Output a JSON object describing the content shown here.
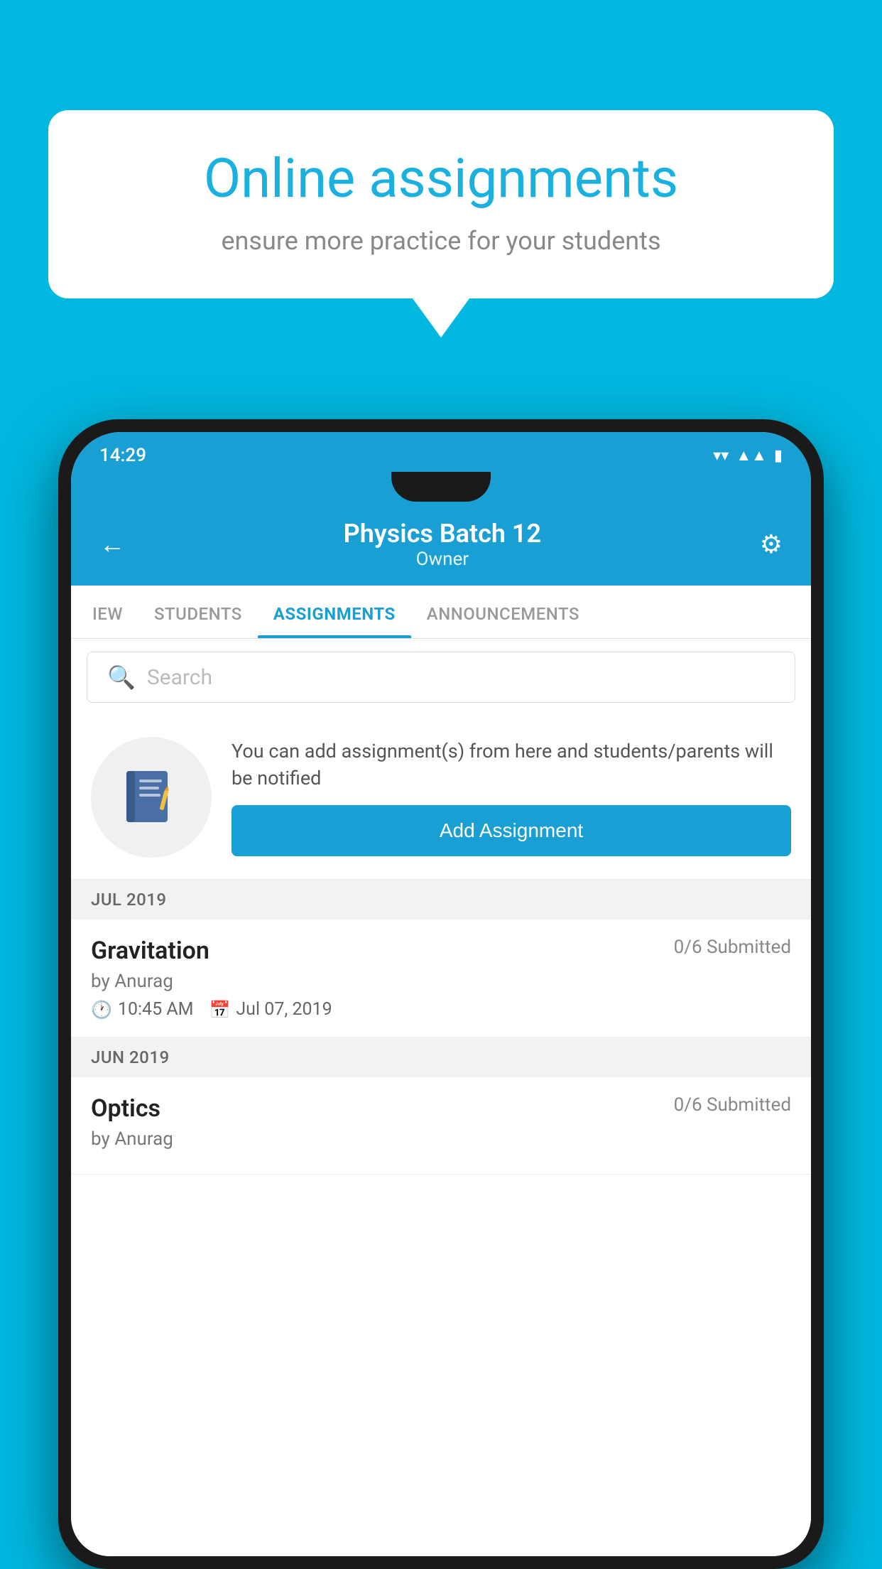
{
  "background_color": "#00b8e0",
  "speech_bubble": {
    "title": "Online assignments",
    "subtitle": "ensure more practice for your students"
  },
  "status_bar": {
    "time": "14:29",
    "icons": [
      "wifi",
      "signal",
      "battery"
    ]
  },
  "app_header": {
    "title": "Physics Batch 12",
    "subtitle": "Owner",
    "back_label": "←",
    "settings_label": "⚙"
  },
  "tabs": [
    {
      "label": "IEW",
      "active": false
    },
    {
      "label": "STUDENTS",
      "active": false
    },
    {
      "label": "ASSIGNMENTS",
      "active": true
    },
    {
      "label": "ANNOUNCEMENTS",
      "active": false
    }
  ],
  "search": {
    "placeholder": "Search"
  },
  "promo": {
    "text": "You can add assignment(s) from here and students/parents will be notified",
    "button_label": "Add Assignment"
  },
  "sections": [
    {
      "header": "JUL 2019",
      "assignments": [
        {
          "name": "Gravitation",
          "submitted": "0/6 Submitted",
          "by": "by Anurag",
          "time": "10:45 AM",
          "date": "Jul 07, 2019"
        }
      ]
    },
    {
      "header": "JUN 2019",
      "assignments": [
        {
          "name": "Optics",
          "submitted": "0/6 Submitted",
          "by": "by Anurag",
          "time": "",
          "date": ""
        }
      ]
    }
  ]
}
